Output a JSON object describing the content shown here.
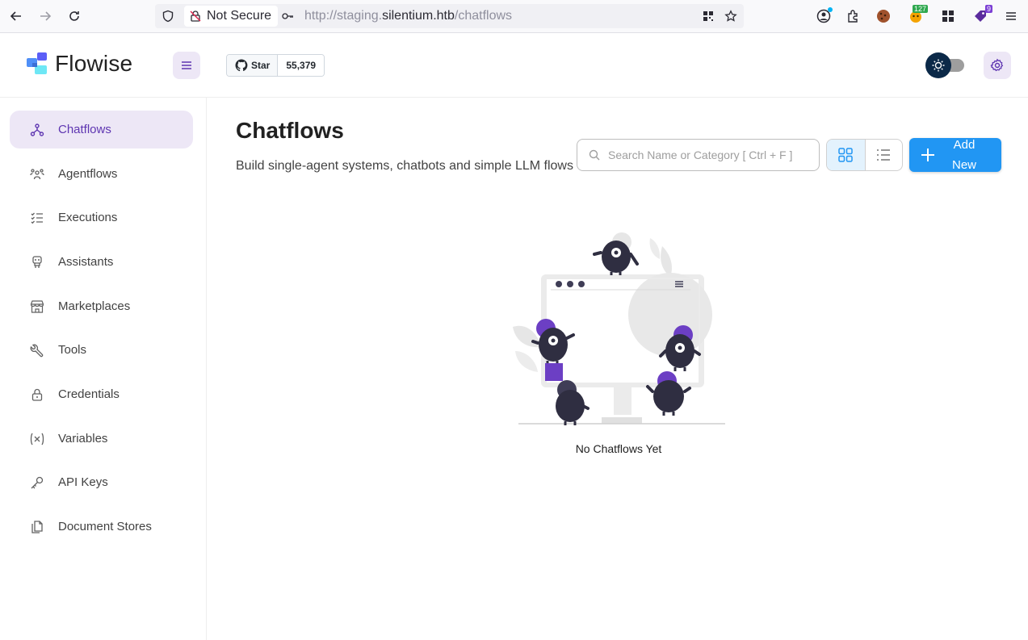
{
  "browser": {
    "security_label": "Not Secure",
    "url_prefix": "http://staging.",
    "url_host": "silentium.htb",
    "url_path": "/chatflows",
    "ext_badge_1": "127",
    "ext_badge_2": "9"
  },
  "header": {
    "logo_text": "Flowise",
    "star_label": "Star",
    "star_count": "55,379"
  },
  "sidebar": {
    "items": [
      {
        "label": "Chatflows",
        "icon": "hierarchy-icon",
        "active": true
      },
      {
        "label": "Agentflows",
        "icon": "users-group-icon",
        "active": false
      },
      {
        "label": "Executions",
        "icon": "list-check-icon",
        "active": false
      },
      {
        "label": "Assistants",
        "icon": "robot-icon",
        "active": false
      },
      {
        "label": "Marketplaces",
        "icon": "building-store-icon",
        "active": false
      },
      {
        "label": "Tools",
        "icon": "tool-icon",
        "active": false
      },
      {
        "label": "Credentials",
        "icon": "lock-icon",
        "active": false
      },
      {
        "label": "Variables",
        "icon": "variable-icon",
        "active": false
      },
      {
        "label": "API Keys",
        "icon": "key-icon",
        "active": false
      },
      {
        "label": "Document Stores",
        "icon": "files-icon",
        "active": false
      }
    ]
  },
  "main": {
    "title": "Chatflows",
    "description": "Build single-agent systems, chatbots and simple LLM flows",
    "search_placeholder": "Search Name or Category [ Ctrl + F ]",
    "add_label": "Add New",
    "empty_message": "No Chatflows Yet"
  },
  "colors": {
    "primary": "#2196f3",
    "accent": "#5e35b1",
    "accent_bg": "#ede7f6"
  }
}
